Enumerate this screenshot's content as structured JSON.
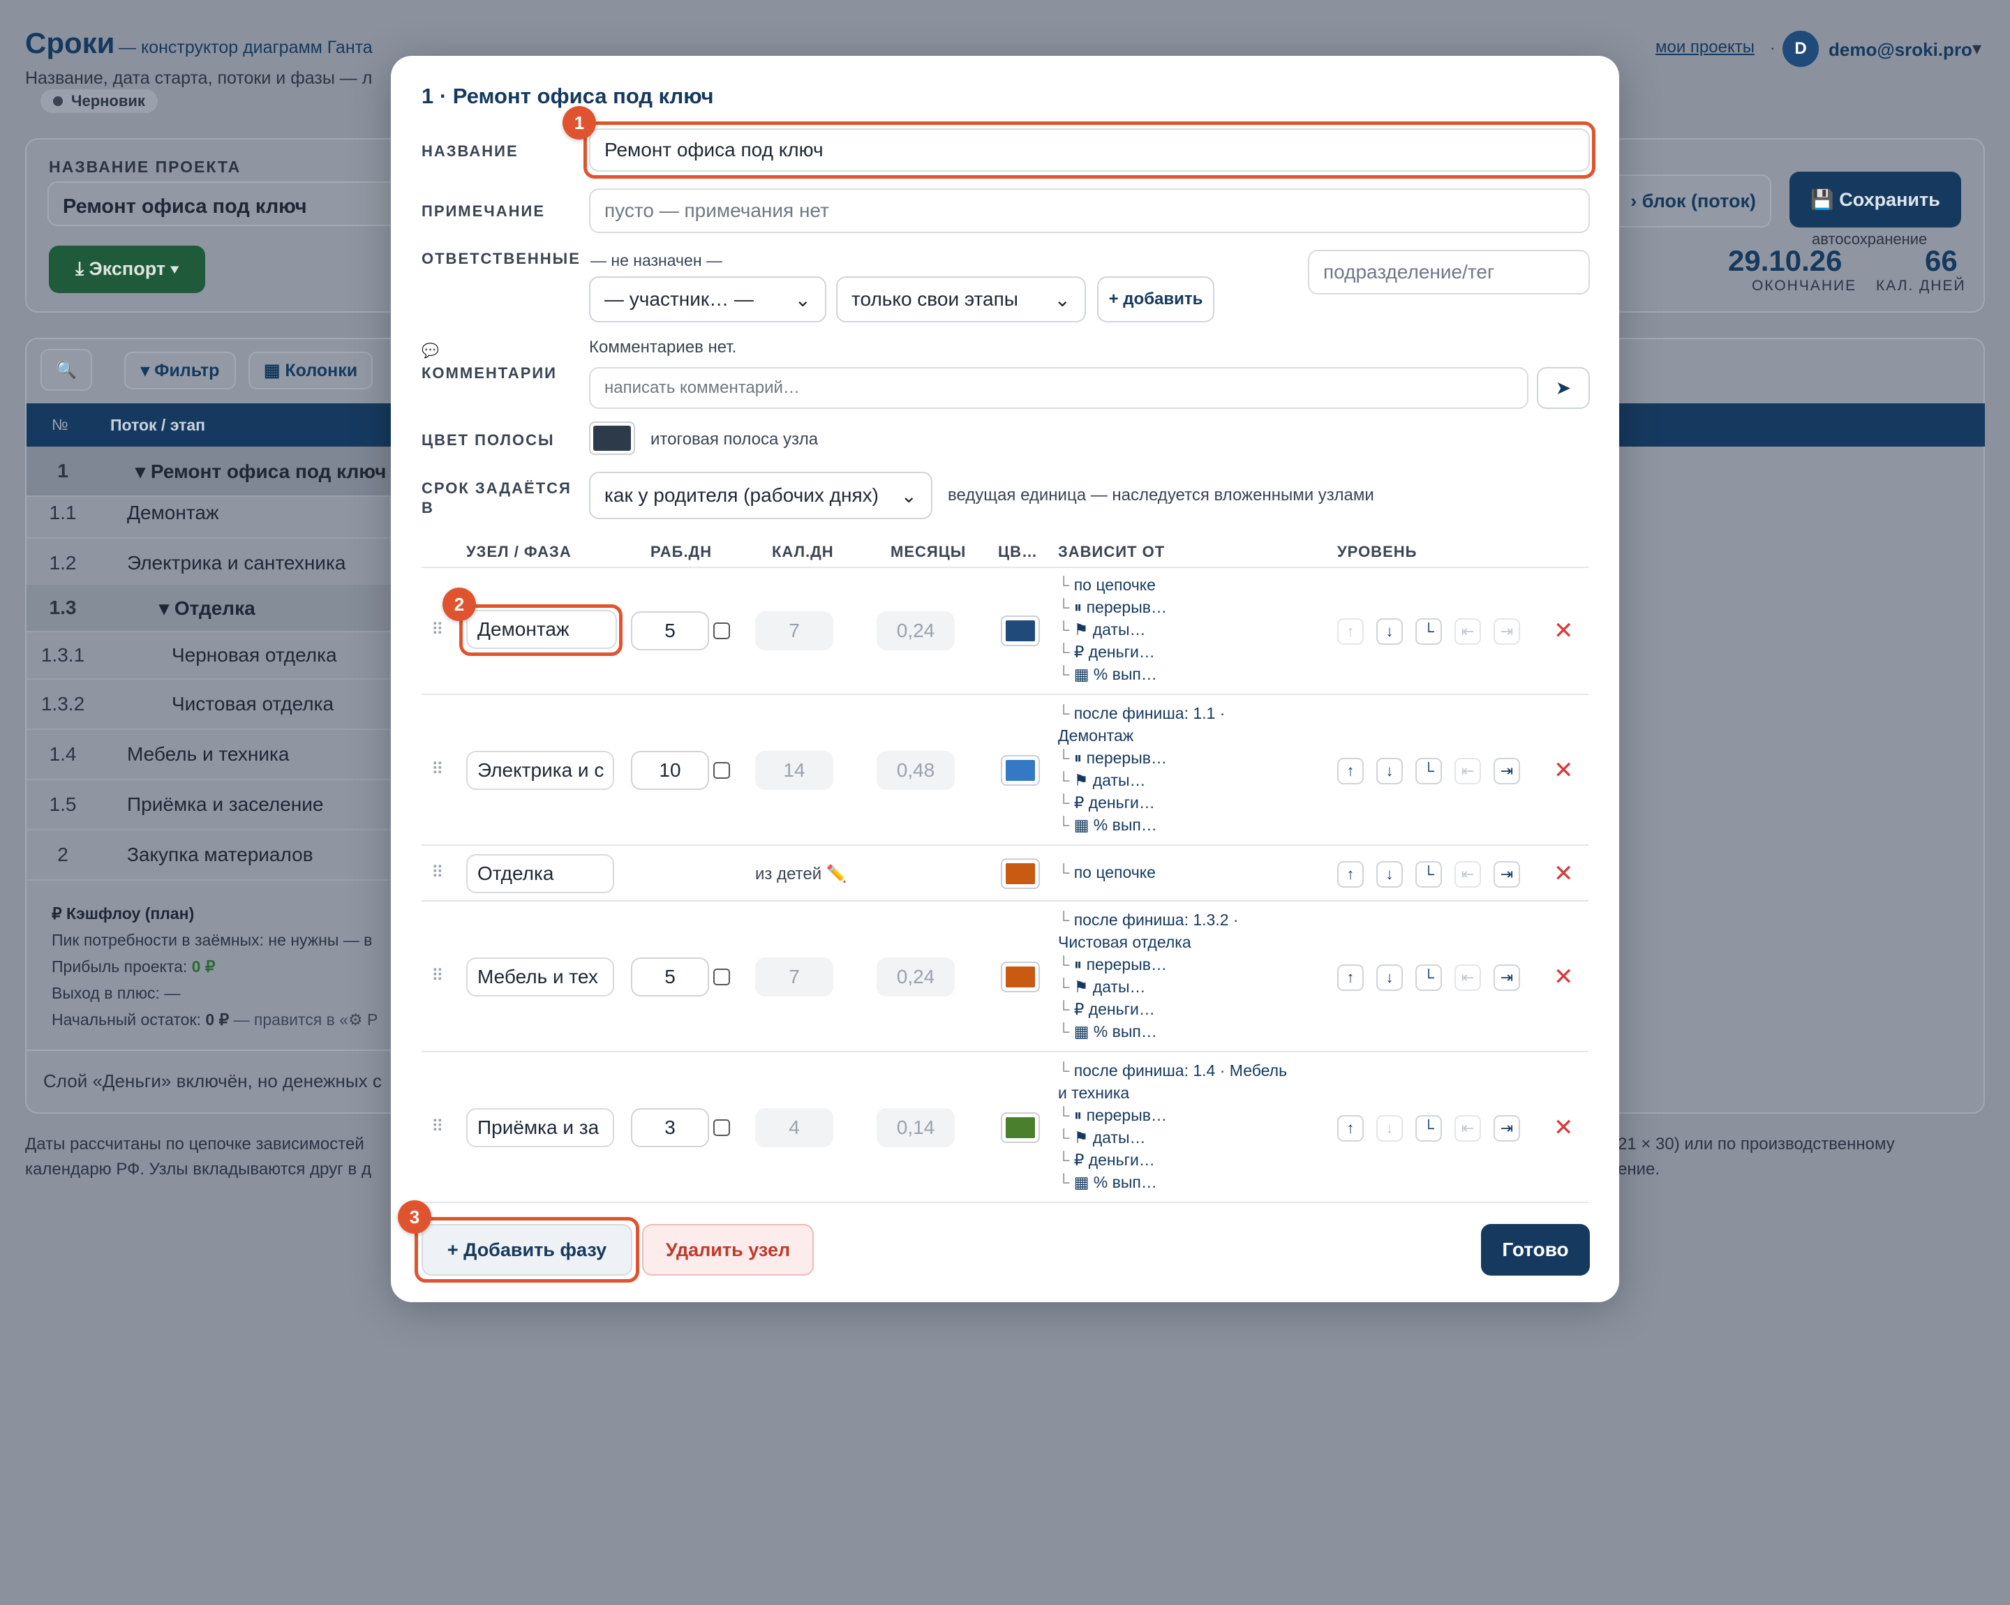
{
  "app": {
    "title": "Сроки",
    "subtitle": "— конструктор диаграмм Ганта",
    "hint": "Название, дата старта, потоки и фазы — л",
    "status": "Черновик",
    "my_projects": "мои проекты",
    "sep": "·",
    "user_email": "demo@sroki.pro",
    "avatar_letter": "D"
  },
  "background": {
    "project_label": "НАЗВАНИЕ ПРОЕКТА",
    "project_name": "Ремонт офиса под ключ",
    "export_btn": "⤓ Экспорт ▾",
    "block_btn": "› блок (поток)",
    "save_btn": "💾 Сохранить",
    "autosave": "автосохранение",
    "end_date": "29.10.26",
    "end_label": "ОКОНЧАНИЕ",
    "days": "66",
    "days_label": "КАЛ. ДНЕЙ",
    "filter_btn": "▾ Фильтр",
    "columns_btn": "▦ Колонки",
    "col_no": "№",
    "col_stream": "Поток / этап",
    "rows": [
      {
        "n": "1",
        "t": "▾ Ремонт офиса под ключ"
      },
      {
        "n": "1.1",
        "t": "Демонтаж"
      },
      {
        "n": "1.2",
        "t": "Электрика и сантехника"
      },
      {
        "n": "1.3",
        "t": "▾ Отделка"
      },
      {
        "n": "1.3.1",
        "t": "Черновая отделка"
      },
      {
        "n": "1.3.2",
        "t": "Чистовая отделка"
      },
      {
        "n": "1.4",
        "t": "Мебель и техника"
      },
      {
        "n": "1.5",
        "t": "Приёмка и заселение"
      },
      {
        "n": "2",
        "t": "Закупка материалов"
      }
    ],
    "cashflow_title": "₽ Кэшфлоу (план)",
    "cash_1": "Пик потребности в заёмных: не нужны — в",
    "cash_2_label": "Прибыль проекта: ",
    "cash_2_val": "0 ₽",
    "cash_3": "Выход в плюс: —",
    "cash_4_label": "Начальный остаток: ",
    "cash_4_val": "0 ₽",
    "cash_4_rest": " — правится в «⚙ Р",
    "money_note": "Слой «Деньги» включён, но денежных с",
    "foot_1": "Даты рассчитаны по цепочке зависимостей",
    "foot_1r": "21 × 30) или по производственному",
    "foot_2": "календарю РФ. Узлы вкладываются друг в д",
    "foot_2r": "ение."
  },
  "modal": {
    "title": "1 · Ремонт офиса под ключ",
    "name_label": "НАЗВАНИЕ",
    "name_value": "Ремонт офиса под ключ",
    "note_label": "ПРИМЕЧАНИЕ",
    "note_placeholder": "пусто — примечания нет",
    "resp_label": "ОТВЕТСТВЕННЫЕ",
    "resp_none": "— не назначен —",
    "participant_select": "— участник… —",
    "scope_select": "только свои этапы",
    "add_btn": "+ добавить",
    "dept_placeholder": "подразделение/тег",
    "comments_icon": "💬",
    "comments_label": "КОММЕНТАРИИ",
    "comments_none": "Комментариев нет.",
    "comment_placeholder": "написать комментарий…",
    "send": "➤",
    "color_label": "ЦВЕТ ПОЛОСЫ",
    "color_note": "итоговая полоса узла",
    "color_value": "#2d3a4a",
    "term_label_1": "СРОК ЗАДАЁТСЯ",
    "term_label_2": "В",
    "term_select": "как у родителя (рабочих днях)",
    "term_note": "ведущая единица — наследуется вложенными узлами",
    "cols": {
      "node": "УЗЕЛ / ФАЗА",
      "work": "РАБ.ДН",
      "cal": "КАЛ.ДН",
      "months": "МЕСЯЦЫ",
      "color": "ЦВ…",
      "depends": "ЗАВИСИТ ОТ",
      "level": "УРОВЕНЬ"
    },
    "phases": [
      {
        "name": "Демонтаж",
        "work": "5",
        "cal": "7",
        "months": "0,24",
        "color": "#1f4a7a",
        "dep": [
          "по цепочке"
        ]
      },
      {
        "name": "Электрика и с",
        "work": "10",
        "cal": "14",
        "months": "0,48",
        "color": "#3579c4",
        "dep": [
          "после финиша: 1.1 ·",
          "Демонтаж"
        ]
      },
      {
        "name": "Отделка",
        "children_note": "из детей ✏️",
        "color": "#c85a12",
        "dep": [
          "по цепочке"
        ]
      },
      {
        "name": "Мебель и тех",
        "work": "5",
        "cal": "7",
        "months": "0,24",
        "color": "#c85a12",
        "dep": [
          "после финиша: 1.3.2 ·",
          "Чистовая отделка"
        ]
      },
      {
        "name": "Приёмка и за",
        "work": "3",
        "cal": "4",
        "months": "0,14",
        "color": "#4a7f2e",
        "dep": [
          "после финиша: 1.4 · Мебель",
          "и техника"
        ]
      }
    ],
    "extras": [
      "⏸ перерыв…",
      "⚑ даты…",
      "₽ деньги…",
      "▦ % вып…"
    ],
    "add_phase_btn": "+ Добавить фазу",
    "delete_node_btn": "Удалить узел",
    "done_btn": "Готово",
    "badges": [
      "1",
      "2",
      "3"
    ]
  }
}
